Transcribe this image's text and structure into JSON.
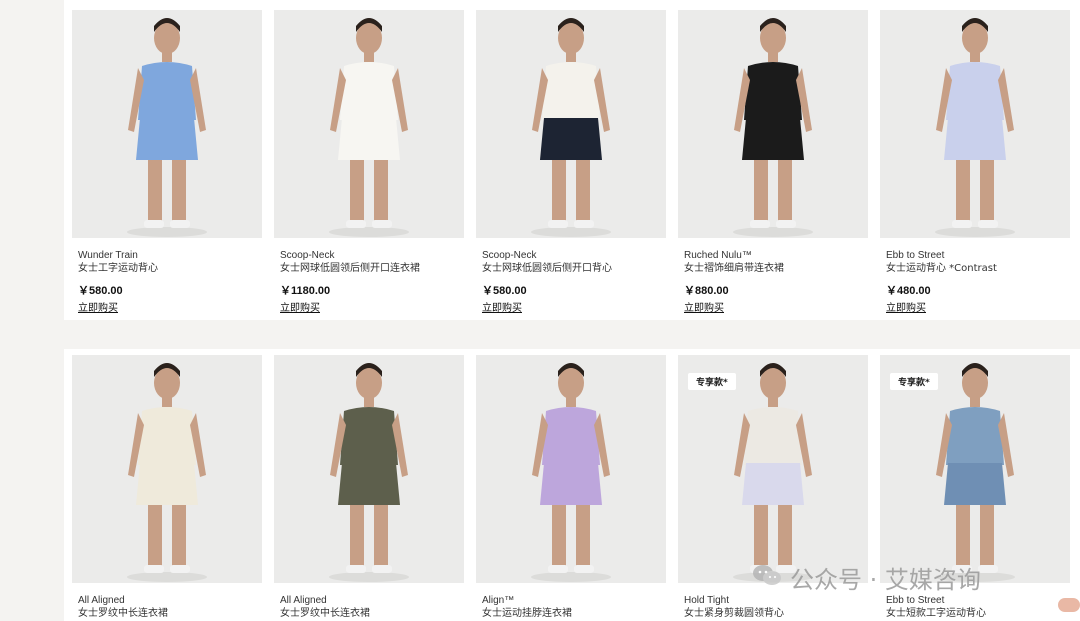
{
  "products": [
    {
      "name": "Wunder Train",
      "subtitle": "女士工字运动背心",
      "price": "￥580.00",
      "cta": "立即购买",
      "badge": "",
      "colors": {
        "top": "#7fa7dd",
        "bottom": "#7fa7dd"
      }
    },
    {
      "name": "Scoop-Neck",
      "subtitle": "女士网球低圆领后侧开口连衣裙",
      "price": "￥1180.00",
      "cta": "立即购买",
      "badge": "",
      "colors": {
        "top": "#f7f6f2",
        "bottom": "#f7f6f2"
      }
    },
    {
      "name": "Scoop-Neck",
      "subtitle": "女士网球低圆领后侧开口背心",
      "price": "￥580.00",
      "cta": "立即购买",
      "badge": "",
      "colors": {
        "top": "#f4f2ec",
        "bottom": "#1d2433"
      }
    },
    {
      "name": "Ruched Nulu™",
      "subtitle": "女士褶饰细肩带连衣裙",
      "price": "￥880.00",
      "cta": "立即购买",
      "badge": "",
      "colors": {
        "top": "#1b1b1b",
        "bottom": "#1b1b1b"
      }
    },
    {
      "name": "Ebb to Street",
      "subtitle": "女士运动背心 *Contrast",
      "price": "￥480.00",
      "cta": "立即购买",
      "badge": "",
      "colors": {
        "top": "#c9d0ec",
        "bottom": "#c9d0ec"
      }
    },
    {
      "name": "All Aligned",
      "subtitle": "女士罗纹中长连衣裙",
      "price": "",
      "cta": "",
      "badge": "",
      "colors": {
        "top": "#efeadb",
        "bottom": "#efeadb"
      }
    },
    {
      "name": "All Aligned",
      "subtitle": "女士罗纹中长连衣裙",
      "price": "",
      "cta": "",
      "badge": "",
      "colors": {
        "top": "#5d5f4c",
        "bottom": "#5d5f4c"
      }
    },
    {
      "name": "Align™",
      "subtitle": "女士运动挂脖连衣裙",
      "price": "",
      "cta": "",
      "badge": "",
      "colors": {
        "top": "#bda6dc",
        "bottom": "#bda6dc"
      }
    },
    {
      "name": "Hold Tight",
      "subtitle": "女士紧身剪裁圆领背心",
      "price": "",
      "cta": "",
      "badge": "专享款*",
      "colors": {
        "top": "#ece9e3",
        "bottom": "#d9d9ec"
      }
    },
    {
      "name": "Ebb to Street",
      "subtitle": "女士短款工字运动背心",
      "price": "",
      "cta": "",
      "badge": "专享款*",
      "colors": {
        "top": "#7f9fc0",
        "bottom": "#6f8fb4"
      }
    }
  ],
  "watermark": {
    "text": "公众号 · 艾媒咨询"
  }
}
